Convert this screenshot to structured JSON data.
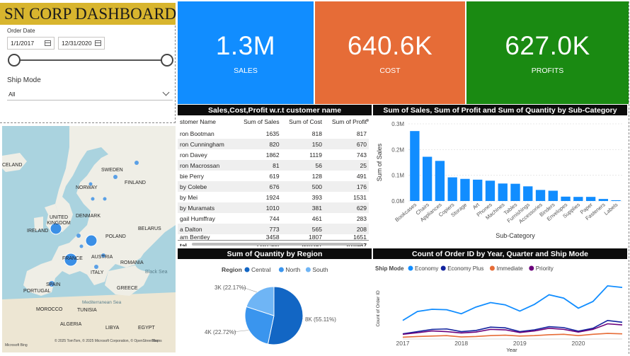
{
  "header": {
    "title": "SN CORP DASHBOARD"
  },
  "filters": {
    "order_date_label": "Order Date",
    "date_from": "1/1/2017",
    "date_to": "12/31/2020",
    "ship_mode_label": "Ship Mode",
    "ship_mode_value": "All"
  },
  "kpis": [
    {
      "value": "1.3M",
      "label": "SALES",
      "color": "#118dff"
    },
    {
      "value": "640.6K",
      "label": "COST",
      "color": "#e66c37"
    },
    {
      "value": "627.0K",
      "label": "PROFITS",
      "color": "#1a8a12"
    }
  ],
  "map": {
    "labels": [
      "CELAND",
      "SWEDEN",
      "FINLAND",
      "NORWAY",
      "UNITED KINGDOM",
      "DENMARK",
      "IRELAND",
      "POLAND",
      "BELARUS",
      "FRANCE",
      "AUSTRIA",
      "ROMANIA",
      "ITALY",
      "Black Sea",
      "PORTUGAL",
      "SPAIN",
      "GREECE",
      "Mediterranean Sea",
      "MOROCCO",
      "TUNISIA",
      "ALGERIA",
      "LIBYA",
      "EGYPT"
    ],
    "attribution": "© 2025 TomTom, © 2025 Microsoft Corporation, © OpenStreetMap",
    "terms": "Terms",
    "bing": "Microsoft Bing"
  },
  "customer_table": {
    "title": "Sales,Cost,Profit w.r.t customer name",
    "columns": [
      "stomer Name",
      "Sum of Sales",
      "Sum of Cost",
      "Sum of Profit"
    ],
    "rows": [
      [
        "ron Bootman",
        "1635",
        "818",
        "817"
      ],
      [
        "ron Cunningham",
        "820",
        "150",
        "670"
      ],
      [
        "ron Davey",
        "1862",
        "1119",
        "743"
      ],
      [
        "ron Macrossan",
        "81",
        "56",
        "25"
      ],
      [
        "bie Perry",
        "619",
        "128",
        "491"
      ],
      [
        "by Colebe",
        "676",
        "500",
        "176"
      ],
      [
        "by Mei",
        "1924",
        "393",
        "1531"
      ],
      [
        "by Muramats",
        "1010",
        "381",
        "629"
      ],
      [
        "gail Humffray",
        "744",
        "461",
        "283"
      ],
      [
        "a Dalton",
        "773",
        "565",
        "208"
      ],
      [
        "am Bentley",
        "3458",
        "1807",
        "1651"
      ]
    ],
    "total": [
      "tal",
      "1267564",
      "640597",
      "626967"
    ]
  },
  "subcat_chart": {
    "title": "Sum of Sales, Sum of Profit and Sum of Quantity by Sub-Category",
    "chart_data": {
      "type": "bar",
      "xlabel": "Sub-Category",
      "ylabel": "Sum of Sales",
      "ylim": [
        0,
        300000
      ],
      "yticks": [
        "0.0M",
        "0.1M",
        "0.2M",
        "0.3M"
      ],
      "categories": [
        "Bookcases",
        "Chairs",
        "Appliances",
        "Copiers",
        "Storage",
        "Art",
        "Phones",
        "Machines",
        "Tables",
        "Furnishings",
        "Accessories",
        "Binders",
        "Envelopes",
        "Supplies",
        "Paper",
        "Fasteners",
        "Labels"
      ],
      "values": [
        272000,
        172000,
        156000,
        92000,
        86000,
        83000,
        79000,
        68000,
        67000,
        57000,
        43000,
        40000,
        17000,
        16000,
        16000,
        8000,
        3000
      ],
      "color": "#118dff"
    }
  },
  "region_chart": {
    "title": "Sum of Quantity by Region",
    "legend_title": "Region",
    "chart_data": {
      "type": "pie",
      "categories": [
        "Central",
        "North",
        "South"
      ],
      "values": [
        8000,
        4000,
        3000
      ],
      "labels": [
        "8K (55.11%)",
        "4K (22.72%)",
        "3K (22.17%)"
      ],
      "colors": [
        "#1266c4",
        "#3a95ee",
        "#6fb5f5"
      ]
    }
  },
  "line_chart": {
    "title": "Count of Order ID by Year, Quarter and Ship Mode",
    "legend_title": "Ship Mode",
    "chart_data": {
      "type": "line",
      "xlabel": "Year",
      "ylabel": "Count of Order ID",
      "x": [
        "2017",
        "",
        "",
        "",
        "2018",
        "",
        "",
        "",
        "2019",
        "",
        "",
        "",
        "2020",
        "",
        "",
        ""
      ],
      "xticks": [
        "2017",
        "2018",
        "2019",
        "2020"
      ],
      "series": [
        {
          "name": "Economy",
          "color": "#118dff",
          "values": [
            80,
            120,
            130,
            128,
            110,
            140,
            160,
            150,
            122,
            152,
            195,
            180,
            135,
            165,
            235,
            228
          ]
        },
        {
          "name": "Economy Plus",
          "color": "#12239e",
          "values": [
            20,
            30,
            40,
            42,
            30,
            35,
            50,
            47,
            30,
            38,
            52,
            48,
            32,
            45,
            80,
            72
          ]
        },
        {
          "name": "Immediate",
          "color": "#e66c37",
          "values": [
            5,
            8,
            10,
            12,
            6,
            8,
            12,
            14,
            10,
            12,
            16,
            18,
            12,
            18,
            22,
            20
          ]
        },
        {
          "name": "Priority",
          "color": "#6b007b",
          "values": [
            18,
            25,
            33,
            30,
            24,
            28,
            40,
            38,
            26,
            33,
            45,
            40,
            28,
            40,
            65,
            60
          ]
        }
      ]
    }
  }
}
